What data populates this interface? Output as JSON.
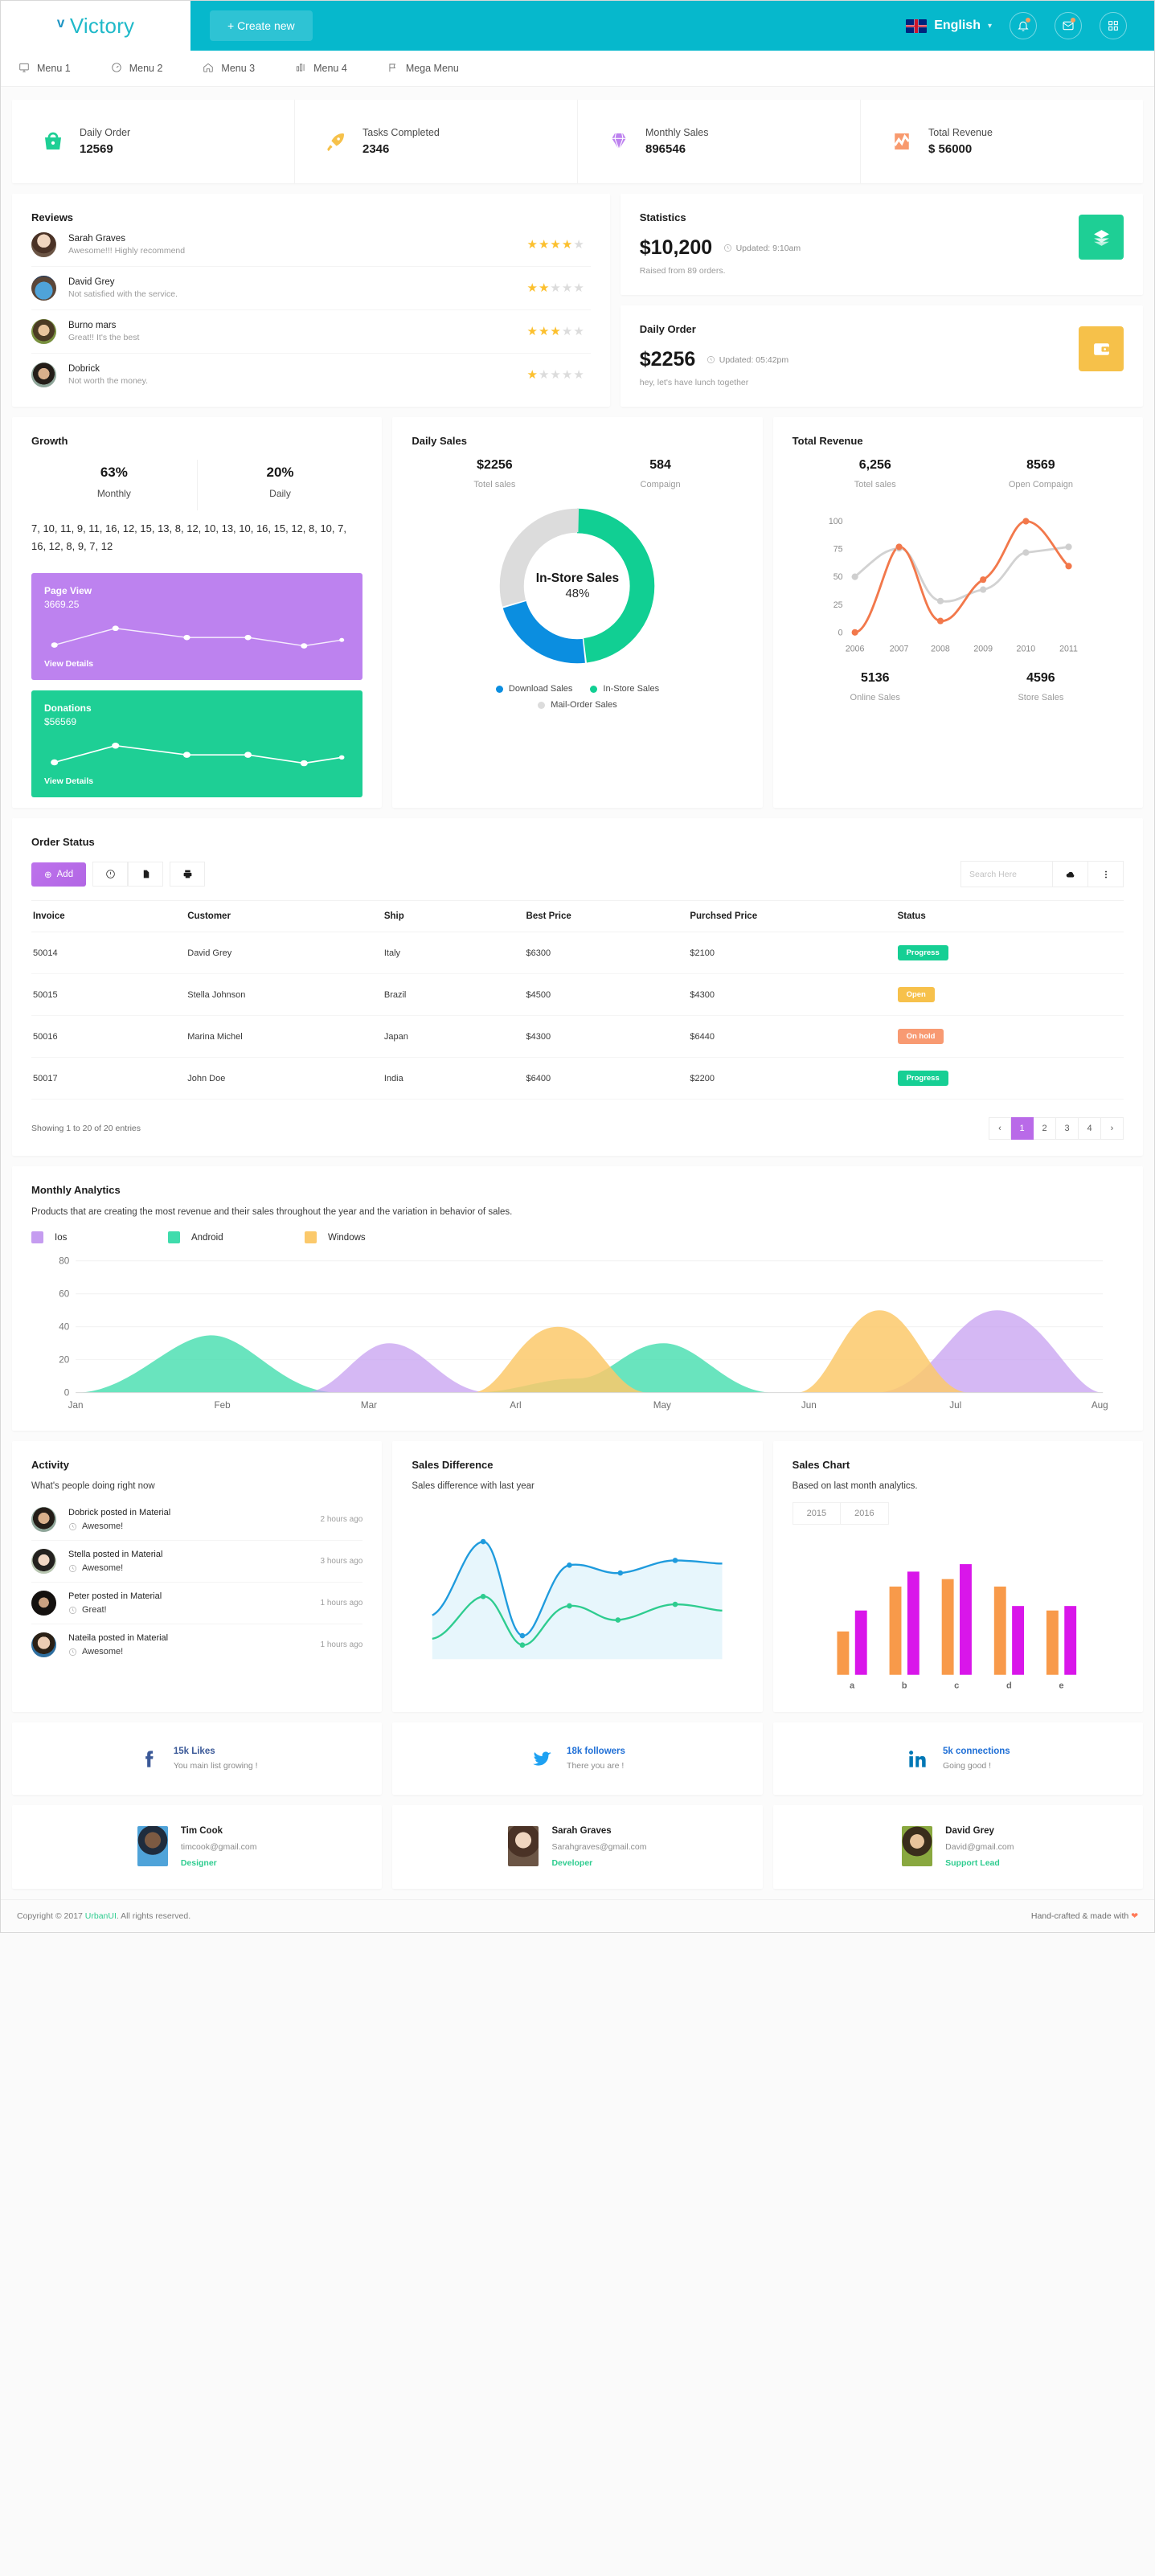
{
  "header": {
    "brand": "Victory",
    "create_button": "+ Create new",
    "language": "English",
    "icons": [
      "bell-icon",
      "envelope-icon",
      "grid-icon"
    ]
  },
  "menu": [
    {
      "label": "Menu 1",
      "icon": "monitor-icon"
    },
    {
      "label": "Menu 2",
      "icon": "speedometer-icon"
    },
    {
      "label": "Menu 3",
      "icon": "home-icon"
    },
    {
      "label": "Menu 4",
      "icon": "bar-chart-icon"
    },
    {
      "label": "Mega Menu",
      "icon": "flag-icon"
    }
  ],
  "stats": [
    {
      "label": "Daily Order",
      "value": "12569",
      "icon": "basket-icon",
      "color": "#1ecf95"
    },
    {
      "label": "Tasks Completed",
      "value": "2346",
      "icon": "rocket-icon",
      "color": "#f6c14a"
    },
    {
      "label": "Monthly Sales",
      "value": "896546",
      "icon": "diamond-icon",
      "color": "#bd82ef"
    },
    {
      "label": "Total Revenue",
      "value": "$ 56000",
      "icon": "revenue-chart-icon",
      "color": "#f89a6e"
    }
  ],
  "reviews": {
    "title": "Reviews",
    "items": [
      {
        "name": "Sarah Graves",
        "comment": "Awesome!!! Highly recommend",
        "rating": 4
      },
      {
        "name": "David Grey",
        "comment": "Not satisfied with the service.",
        "rating": 2
      },
      {
        "name": "Burno mars",
        "comment": "Great!! It's the best",
        "rating": 3
      },
      {
        "name": "Dobrick",
        "comment": "Not worth the money.",
        "rating": 1
      }
    ]
  },
  "statistics": {
    "title": "Statistics",
    "amount": "$10,200",
    "updated": "Updated: 9:10am",
    "note": "Raised from 89 orders.",
    "icon": "layers-icon",
    "color": "#1ecf95"
  },
  "daily_order_card": {
    "title": "Daily Order",
    "amount": "$2256",
    "updated": "Updated: 05:42pm",
    "note": "hey, let's have lunch together",
    "icon": "wallet-icon",
    "color": "#f6c14a"
  },
  "growth": {
    "title": "Growth",
    "monthly_pct": "63%",
    "monthly_label": "Monthly",
    "daily_pct": "20%",
    "daily_label": "Daily",
    "numbers": "7, 10, 11, 9, 11, 16, 12, 15, 13, 8, 12, 10, 13, 10, 16, 15, 12, 8, 10, 7, 16, 12, 8, 9, 7, 12",
    "page_view": {
      "title": "Page View",
      "value": "3669.25",
      "link": "View Details",
      "color": "#bd82ef"
    },
    "donations": {
      "title": "Donations",
      "value": "$56569",
      "link": "View Details",
      "color": "#1ecf95"
    }
  },
  "daily_sales": {
    "title": "Daily Sales",
    "total_value": "$2256",
    "total_label": "Totel sales",
    "campaign_value": "584",
    "campaign_label": "Compaign",
    "center_title": "In-Store Sales",
    "center_pct": "48%",
    "legend": [
      {
        "label": "Download Sales",
        "color": "#0b8ee0"
      },
      {
        "label": "In-Store Sales",
        "color": "#11cf93"
      },
      {
        "label": "Mail-Order Sales",
        "color": "#dcdcdc"
      }
    ]
  },
  "total_revenue": {
    "title": "Total Revenue",
    "total_value": "6,256",
    "total_label": "Totel sales",
    "open_value": "8569",
    "open_label": "Open Compaign",
    "online_value": "5136",
    "online_label": "Online Sales",
    "store_value": "4596",
    "store_label": "Store Sales"
  },
  "order_status": {
    "title": "Order Status",
    "add_button": "Add",
    "toolbar_icons": [
      "info-icon",
      "document-icon",
      "printer-icon"
    ],
    "search_placeholder": "Search Here",
    "right_icons": [
      "cloud-icon",
      "more-vertical-icon"
    ],
    "columns": [
      "Invoice",
      "Customer",
      "Ship",
      "Best Price",
      "Purchsed Price",
      "Status"
    ],
    "rows": [
      {
        "invoice": "50014",
        "customer": "David Grey",
        "ship": "Italy",
        "best": "$6300",
        "purchased": "$2100",
        "status": "Progress",
        "status_color": "#16cf94"
      },
      {
        "invoice": "50015",
        "customer": "Stella Johnson",
        "ship": "Brazil",
        "best": "$4500",
        "purchased": "$4300",
        "status": "Open",
        "status_color": "#f7c14b"
      },
      {
        "invoice": "50016",
        "customer": "Marina Michel",
        "ship": "Japan",
        "best": "$4300",
        "purchased": "$6440",
        "status": "On hold",
        "status_color": "#f89a72"
      },
      {
        "invoice": "50017",
        "customer": "John Doe",
        "ship": "India",
        "best": "$6400",
        "purchased": "$2200",
        "status": "Progress",
        "status_color": "#16cf94"
      }
    ],
    "showing": "Showing 1 to 20 of 20 entries",
    "pages": [
      "‹",
      "1",
      "2",
      "3",
      "4",
      "›"
    ],
    "active_page": "1"
  },
  "analytics": {
    "title": "Monthly Analytics",
    "subtitle": "Products that are creating the most revenue and their sales throughout the year and the variation in behavior of sales.",
    "legend": [
      {
        "label": "Ios",
        "color": "#c59cf0"
      },
      {
        "label": "Android",
        "color": "#3fdcac"
      },
      {
        "label": "Windows",
        "color": "#fbc96b"
      }
    ]
  },
  "activity": {
    "title": "Activity",
    "subtitle": "What's people doing right now",
    "items": [
      {
        "text": "Dobrick posted in Material",
        "note": "Awesome!",
        "time": "2 hours ago"
      },
      {
        "text": "Stella posted in Material",
        "note": "Awesome!",
        "time": "3 hours ago"
      },
      {
        "text": "Peter posted in Material",
        "note": "Great!",
        "time": "1 hours ago"
      },
      {
        "text": "Nateila posted in Material",
        "note": "Awesome!",
        "time": "1 hours ago"
      }
    ]
  },
  "sales_difference": {
    "title": "Sales Difference",
    "subtitle": "Sales difference with last year"
  },
  "sales_chart": {
    "title": "Sales Chart",
    "subtitle": "Based on last month analytics.",
    "tabs": [
      "2015",
      "2016"
    ]
  },
  "social": [
    {
      "network": "facebook",
      "count": "15k Likes",
      "note": "You main list growing !",
      "color": "#3b5998"
    },
    {
      "network": "twitter",
      "count": "18k followers",
      "note": "There you are !",
      "color": "#1da1f2"
    },
    {
      "network": "linkedin",
      "count": "5k connections",
      "note": "Going good !",
      "color": "#0077b5"
    }
  ],
  "people": [
    {
      "name": "Tim Cook",
      "email": "timcook@gmail.com",
      "role": "Designer"
    },
    {
      "name": "Sarah Graves",
      "email": "Sarahgraves@gmail.com",
      "role": "Developer"
    },
    {
      "name": "David Grey",
      "email": "David@gmail.com",
      "role": "Support Lead"
    }
  ],
  "footer": {
    "left_prefix": "Copyright © 2017 ",
    "left_link": "UrbanUI",
    "left_suffix": ". All rights reserved.",
    "right": "Hand-crafted & made with "
  },
  "chart_data": [
    {
      "type": "pie",
      "title": "Daily Sales",
      "labels": [
        "In-Store Sales",
        "Download Sales",
        "Mail-Order Sales"
      ],
      "values": [
        48,
        22,
        30
      ],
      "colors": [
        "#11cf93",
        "#0b8ee0",
        "#dcdcdc"
      ],
      "center_label": "In-Store Sales 48%",
      "legend_position": "bottom"
    },
    {
      "type": "line",
      "title": "Total Revenue",
      "x": [
        2006,
        2007,
        2008,
        2009,
        2010,
        2011
      ],
      "series": [
        {
          "name": "Online Sales",
          "color": "#f2784b",
          "values": [
            0,
            78,
            12,
            50,
            100,
            65
          ]
        },
        {
          "name": "Store Sales",
          "color": "#cfcfcf",
          "values": [
            50,
            75,
            30,
            36,
            70,
            78
          ]
        }
      ],
      "xlabel": "",
      "ylabel": "",
      "ylim": [
        0,
        100
      ],
      "yticks": [
        0,
        25,
        50,
        75,
        100
      ],
      "grid": false,
      "legend_position": "none"
    },
    {
      "type": "area",
      "title": "Monthly Analytics",
      "categories": [
        "Jan",
        "Feb",
        "Mar",
        "Arl",
        "May",
        "Jun",
        "Jul",
        "Aug"
      ],
      "series": [
        {
          "name": "Ios",
          "color": "#c59cf0",
          "values": [
            0,
            8,
            30,
            8,
            2,
            12,
            50,
            5
          ]
        },
        {
          "name": "Android",
          "color": "#3fdcac",
          "values": [
            0,
            35,
            4,
            12,
            30,
            6,
            0,
            0
          ]
        },
        {
          "name": "Windows",
          "color": "#fbc96b",
          "values": [
            0,
            0,
            6,
            40,
            6,
            50,
            4,
            0
          ]
        }
      ],
      "ylim": [
        0,
        80
      ],
      "yticks": [
        0,
        20,
        40,
        60,
        80
      ],
      "grid": true,
      "legend_position": "top"
    },
    {
      "type": "line",
      "title": "Sales Difference",
      "series": [
        {
          "name": "series-1",
          "color": "#1f9bdd",
          "values": [
            28,
            72,
            20,
            58,
            54,
            60,
            57
          ]
        },
        {
          "name": "series-2",
          "color": "#2ecc8f",
          "values": [
            15,
            35,
            12,
            30,
            24,
            34,
            30
          ]
        }
      ],
      "grid": false,
      "legend_position": "none"
    },
    {
      "type": "bar",
      "title": "Sales Chart",
      "categories": [
        "a",
        "b",
        "c",
        "d",
        "e"
      ],
      "series": [
        {
          "name": "2015",
          "color": "#f89a4a",
          "values": [
            22,
            52,
            58,
            52,
            36
          ]
        },
        {
          "name": "2016",
          "color": "#d916ea",
          "values": [
            34,
            62,
            67,
            40,
            40
          ]
        }
      ],
      "ylim": [
        0,
        80
      ],
      "grid": false,
      "legend_position": "top"
    }
  ]
}
